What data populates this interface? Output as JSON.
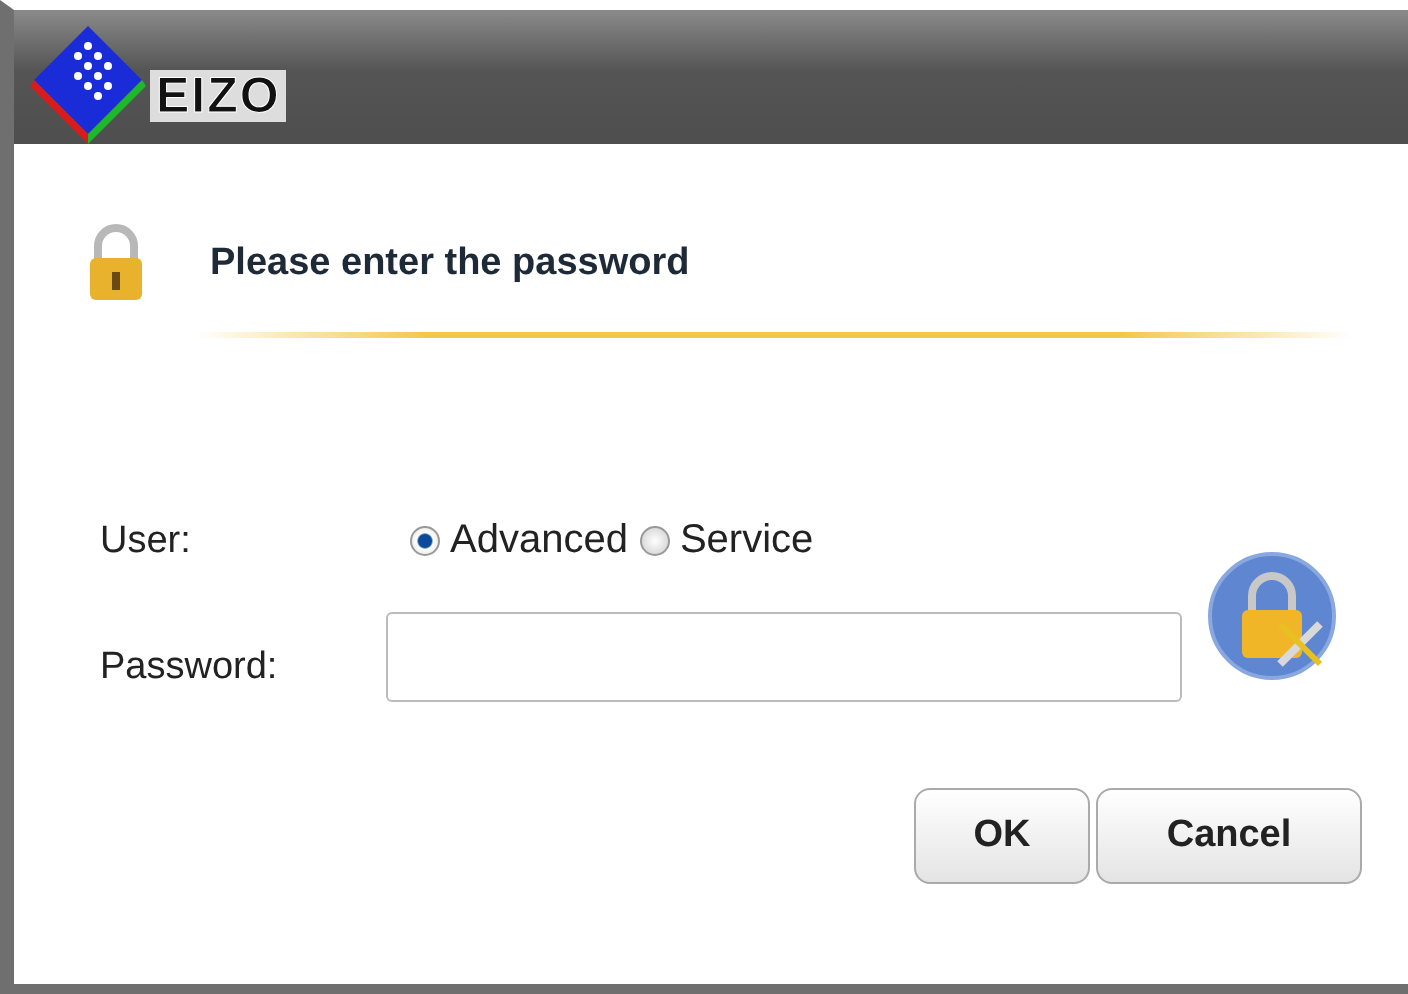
{
  "header": {
    "logo": "EIZO"
  },
  "title": "Please enter the password",
  "user": {
    "label": "User:",
    "options": [
      {
        "label": "Advanced",
        "selected": true
      },
      {
        "label": "Service",
        "selected": false
      }
    ]
  },
  "password": {
    "label": "Password:"
  },
  "buttons": [
    "OK",
    "Cancel"
  ]
}
